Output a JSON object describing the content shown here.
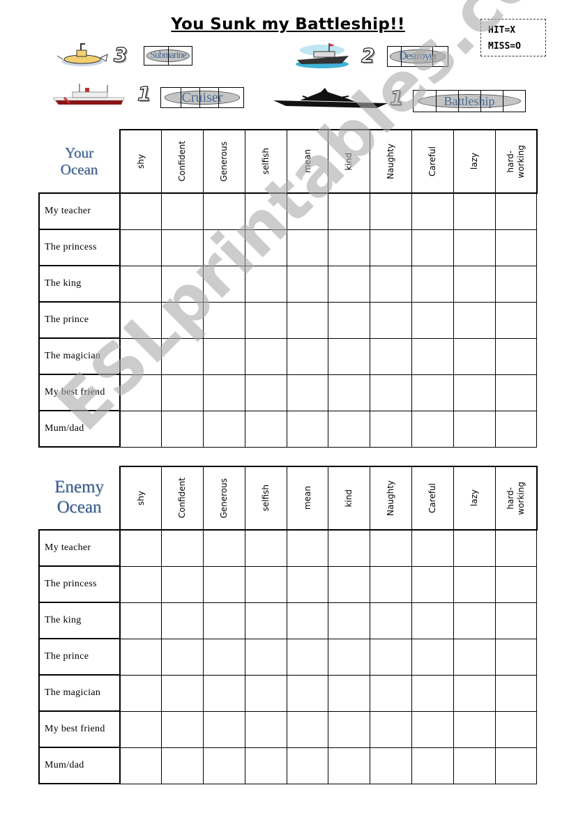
{
  "title": "You Sunk my Battleship!!",
  "key": {
    "hit": "HIT=X",
    "miss": "MISS=O"
  },
  "ships": [
    {
      "name": "Submarine",
      "count": "3",
      "icon": "submarine-icon"
    },
    {
      "name": "Destroyer",
      "count": "2",
      "icon": "destroyer-icon"
    },
    {
      "name": "Cruiser",
      "count": "1",
      "icon": "cruiser-icon"
    },
    {
      "name": "Battleship",
      "count": "1",
      "icon": "battleship-icon"
    }
  ],
  "columns": [
    "shy",
    "Confident",
    "Generous",
    "selfish",
    "mean",
    "kind",
    "Naughty",
    "Careful",
    "lazy",
    "hard-\nworking"
  ],
  "rows": [
    "My teacher",
    "The princess",
    "The king",
    "The prince",
    "The magician",
    "My best friend",
    "Mum/dad"
  ],
  "your_ocean": {
    "line1": "Your",
    "line2": "Ocean"
  },
  "enemy_ocean": {
    "line1": "Enemy",
    "line2": "Ocean"
  },
  "watermark": "ESLprintables.com",
  "colors": {
    "ocean_title": "#3c5d8c",
    "ship_label": "#4a6c94",
    "watermark": "#c8c8c8"
  }
}
